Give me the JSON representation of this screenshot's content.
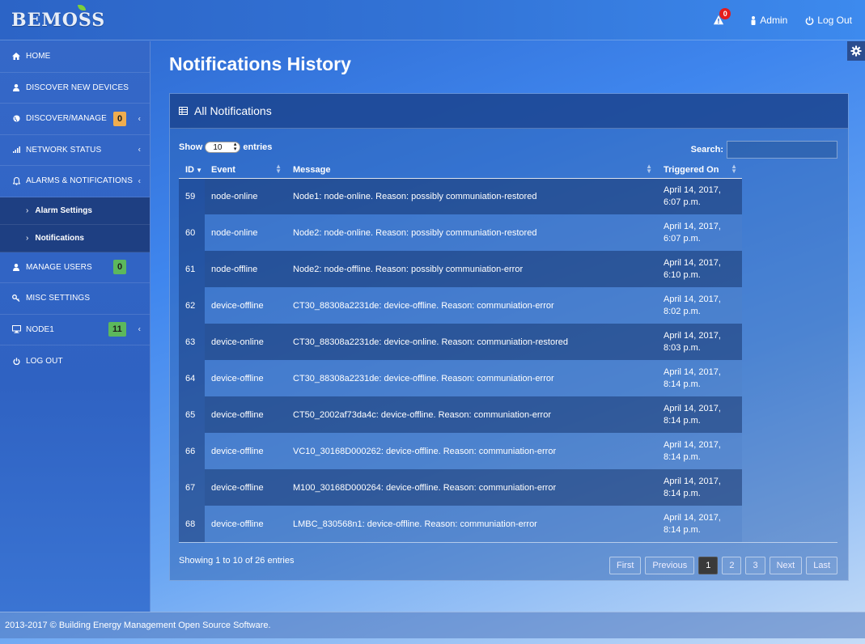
{
  "app": {
    "logo": "BEMOSS"
  },
  "header": {
    "alert_count": "0",
    "admin_label": "Admin",
    "logout_label": "Log Out"
  },
  "sidebar": {
    "items": [
      {
        "label": "HOME",
        "icon": "home-icon"
      },
      {
        "label": "DISCOVER NEW DEVICES",
        "icon": "user-icon"
      },
      {
        "label": "DISCOVER/MANAGE",
        "icon": "globe-icon",
        "badge": "0"
      },
      {
        "label": "NETWORK STATUS",
        "icon": "signal-icon"
      },
      {
        "label": "ALARMS & NOTIFICATIONS",
        "icon": "bell-icon"
      },
      {
        "label": "MANAGE USERS",
        "icon": "user-icon",
        "badge": "0"
      },
      {
        "label": "MISC SETTINGS",
        "icon": "key-icon"
      },
      {
        "label": "NODE1",
        "icon": "monitor-icon",
        "badge": "11"
      },
      {
        "label": "LOG OUT",
        "icon": "power-icon"
      }
    ],
    "sub_items": [
      {
        "label": "Alarm Settings"
      },
      {
        "label": "Notifications"
      }
    ]
  },
  "main": {
    "title": "Notifications History",
    "panel_title": "All Notifications",
    "show_label": "Show",
    "entries_label": "entries",
    "page_length": "10",
    "search_label": "Search:",
    "search_value": "",
    "columns": [
      "ID",
      "Event",
      "Message",
      "Triggered On"
    ],
    "rows": [
      {
        "id": "59",
        "event": "node-online",
        "message": "Node1: node-online. Reason: possibly communiation-restored",
        "date": "April 14, 2017,",
        "time": "6:07 p.m."
      },
      {
        "id": "60",
        "event": "node-online",
        "message": "Node2: node-online. Reason: possibly communiation-restored",
        "date": "April 14, 2017,",
        "time": "6:07 p.m."
      },
      {
        "id": "61",
        "event": "node-offline",
        "message": "Node2: node-offline. Reason: possibly communiation-error",
        "date": "April 14, 2017,",
        "time": "6:10 p.m."
      },
      {
        "id": "62",
        "event": "device-offline",
        "message": "CT30_88308a2231de: device-offline. Reason: communiation-error",
        "date": "April 14, 2017,",
        "time": "8:02 p.m."
      },
      {
        "id": "63",
        "event": "device-online",
        "message": "CT30_88308a2231de: device-online. Reason: communiation-restored",
        "date": "April 14, 2017,",
        "time": "8:03 p.m."
      },
      {
        "id": "64",
        "event": "device-offline",
        "message": "CT30_88308a2231de: device-offline. Reason: communiation-error",
        "date": "April 14, 2017,",
        "time": "8:14 p.m."
      },
      {
        "id": "65",
        "event": "device-offline",
        "message": "CT50_2002af73da4c: device-offline. Reason: communiation-error",
        "date": "April 14, 2017,",
        "time": "8:14 p.m."
      },
      {
        "id": "66",
        "event": "device-offline",
        "message": "VC10_30168D000262: device-offline. Reason: communiation-error",
        "date": "April 14, 2017,",
        "time": "8:14 p.m."
      },
      {
        "id": "67",
        "event": "device-offline",
        "message": "M100_30168D000264: device-offline. Reason: communiation-error",
        "date": "April 14, 2017,",
        "time": "8:14 p.m."
      },
      {
        "id": "68",
        "event": "device-offline",
        "message": "LMBC_830568n1: device-offline. Reason: communiation-error",
        "date": "April 14, 2017,",
        "time": "8:14 p.m."
      }
    ],
    "info": "Showing 1 to 10 of 26 entries",
    "pager": {
      "first": "First",
      "previous": "Previous",
      "pages": [
        "1",
        "2",
        "3"
      ],
      "next": "Next",
      "last": "Last"
    }
  },
  "footer": {
    "text": "2013-2017 © Building Energy Management Open Source Software."
  }
}
